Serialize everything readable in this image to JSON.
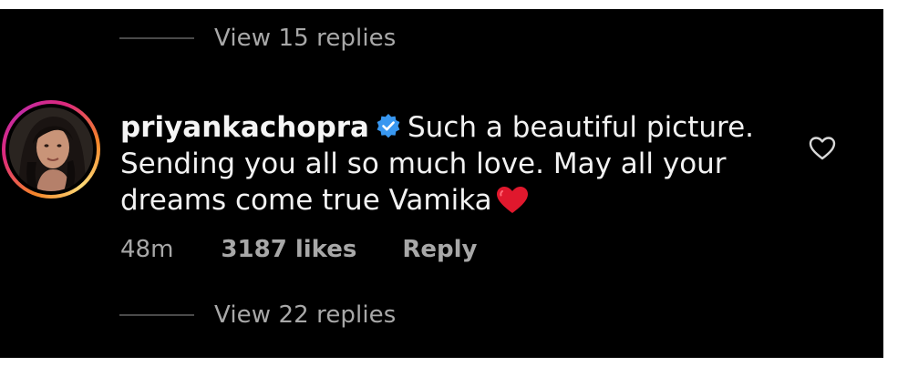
{
  "thread": {
    "view_replies_top": "View 15 replies",
    "view_replies_bottom": "View 22 replies"
  },
  "comment": {
    "username": "priyankachopra",
    "verified": true,
    "text": "Such a beautiful picture. Sending you all so much love. May all your dreams come true Vamika",
    "emoji": "red-heart",
    "time": "48m",
    "likes": "3187 likes",
    "reply_label": "Reply"
  },
  "icons": {
    "verified": "verified-badge-icon",
    "like": "heart-outline-icon"
  },
  "colors": {
    "background": "#000000",
    "text": "#f2f2f2",
    "muted": "#a8a8a8",
    "verified_blue": "#3897f0",
    "heart_red": "#e0182d"
  }
}
